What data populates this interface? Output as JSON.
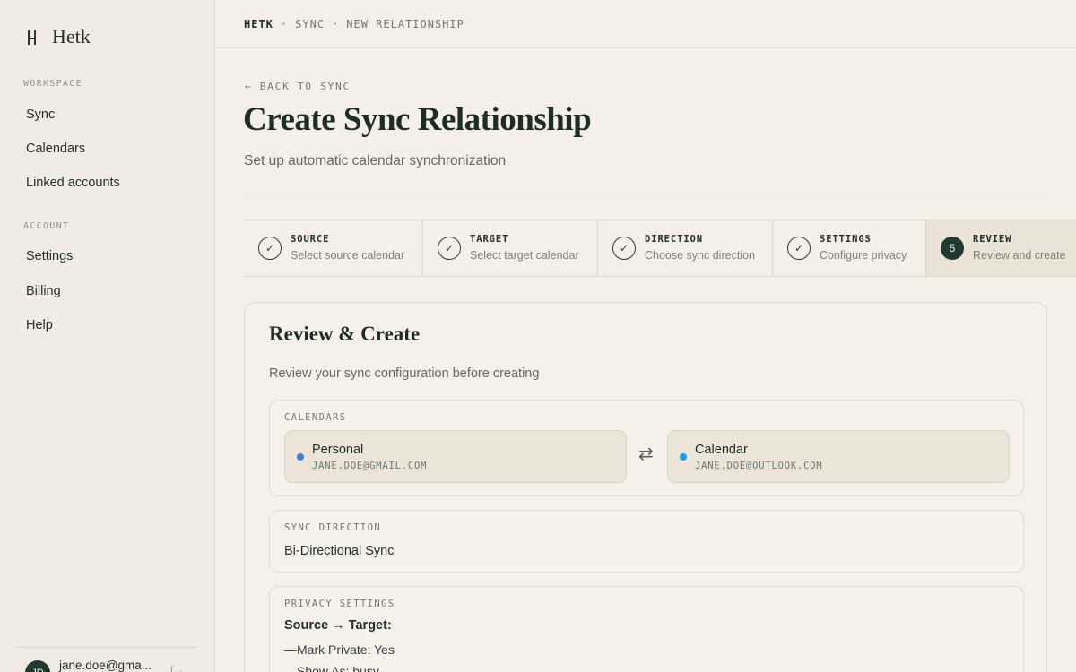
{
  "brand": {
    "name": "Hetk"
  },
  "sidebar": {
    "workspace_label": "WORKSPACE",
    "workspace_items": [
      "Sync",
      "Calendars",
      "Linked accounts"
    ],
    "account_label": "ACCOUNT",
    "account_items": [
      "Settings",
      "Billing",
      "Help"
    ],
    "user": {
      "initials": "JD",
      "email": "jane.doe@gma..."
    }
  },
  "breadcrumb": [
    "HETK",
    "·",
    "SYNC",
    "·",
    "NEW RELATIONSHIP"
  ],
  "header": {
    "back_label": "← BACK TO SYNC",
    "title": "Create Sync Relationship",
    "subtitle": "Set up automatic calendar synchronization"
  },
  "steps": [
    {
      "label": "SOURCE",
      "desc": "Select source calendar",
      "marker": "✓",
      "state": "complete"
    },
    {
      "label": "TARGET",
      "desc": "Select target calendar",
      "marker": "✓",
      "state": "complete"
    },
    {
      "label": "DIRECTION",
      "desc": "Choose sync direction",
      "marker": "✓",
      "state": "complete"
    },
    {
      "label": "SETTINGS",
      "desc": "Configure privacy",
      "marker": "✓",
      "state": "complete"
    },
    {
      "label": "REVIEW",
      "desc": "Review and create",
      "marker": "5",
      "state": "active"
    }
  ],
  "review": {
    "title": "Review & Create",
    "subtitle": "Review your sync configuration before creating",
    "calendars": {
      "label": "CALENDARS",
      "source": {
        "name": "Personal",
        "email": "JANE.DOE@GMAIL.COM",
        "color": "#3f7fe0"
      },
      "target": {
        "name": "Calendar",
        "email": "JANE.DOE@OUTLOOK.COM",
        "color": "#1aa0e6"
      },
      "swap_icon": "bidirectional-arrows-icon"
    },
    "direction": {
      "label": "SYNC DIRECTION",
      "value": "Bi-Directional Sync"
    },
    "privacy": {
      "label": "PRIVACY SETTINGS",
      "heading": "Source → Target:",
      "lines": [
        "—Mark Private: Yes",
        "—Show As: busy"
      ]
    }
  }
}
